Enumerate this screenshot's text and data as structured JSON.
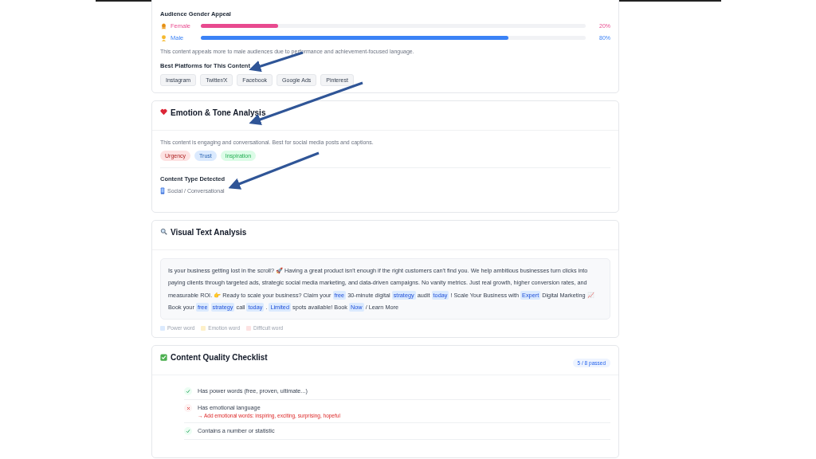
{
  "audience": {
    "title": "Audience Gender Appeal",
    "genders": [
      {
        "label": "Female",
        "kind": "female",
        "level": 0.2,
        "reading": "20%",
        "color": "#e84a8f"
      },
      {
        "label": "Male",
        "kind": "male",
        "level": 0.8,
        "reading": "80%",
        "color": "#3b82f6"
      }
    ],
    "note": "This content appeals more to male audiences due to performance and achievement-focused language.",
    "platforms_title": "Best Platforms for This Content",
    "platforms": [
      "Instagram",
      "Twitter/X",
      "Facebook",
      "Google Ads",
      "Pinterest"
    ]
  },
  "emotion": {
    "title": "Emotion & Tone Analysis",
    "summary": "This content is engaging and conversational. Best for social media posts and captions.",
    "tags": [
      {
        "label": "Urgency",
        "color": "#fde2e2"
      },
      {
        "label": "Trust",
        "color": "#dbeafe"
      },
      {
        "label": "Inspiration",
        "color": "#dcfce7"
      }
    ],
    "content_type_title": "Content Type Detected",
    "content_type": "Social / Conversational"
  },
  "visual": {
    "title": "Visual Text Analysis",
    "segments": [
      {
        "kind": "plain",
        "text": "Is your business getting lost in the scroll? 🚀 Having a great product isn't enough if the right customers can't find you. We help ambitious businesses turn clicks into paying clients through targeted ads, strategic social media marketing, and data-driven campaigns. No vanity metrics. Just real growth, higher conversion rates, and measurable ROI. 👉 Ready to scale your business? Claim your"
      },
      {
        "kind": "power",
        "text": "free"
      },
      {
        "kind": "plain",
        "text": "30-minute digital"
      },
      {
        "kind": "power",
        "text": "strategy"
      },
      {
        "kind": "plain",
        "text": "audit"
      },
      {
        "kind": "power",
        "text": "today"
      },
      {
        "kind": "plain",
        "text": "! Scale Your Business with"
      },
      {
        "kind": "power",
        "text": "Expert"
      },
      {
        "kind": "plain",
        "text": "Digital Marketing 📈 Book your"
      },
      {
        "kind": "power",
        "text": "free"
      },
      {
        "kind": "power",
        "text": "strategy"
      },
      {
        "kind": "plain",
        "text": "call"
      },
      {
        "kind": "power",
        "text": "today"
      },
      {
        "kind": "plain",
        "text": "."
      },
      {
        "kind": "power",
        "text": "Limited"
      },
      {
        "kind": "plain",
        "text": "spots available! Book"
      },
      {
        "kind": "power",
        "text": "Now"
      },
      {
        "kind": "plain",
        "text": "/ Learn More"
      }
    ],
    "legend": [
      {
        "label": "Power word",
        "color": "#dbeafe"
      },
      {
        "label": "Emotion word",
        "color": "#fdf0c8"
      },
      {
        "label": "Difficult word",
        "color": "#fde2e2"
      }
    ]
  },
  "checklist": {
    "title": "Content Quality Checklist",
    "badge": "5 / 8 passed",
    "items": [
      {
        "label": "Has power words (free, proven, ultimate...)",
        "passed": true
      },
      {
        "label": "Has emotional language",
        "passed": false,
        "hint": "→ Add emotional words: inspiring, exciting, surprising, hopeful"
      },
      {
        "label": "Contains a number or statistic",
        "passed": true
      }
    ]
  }
}
